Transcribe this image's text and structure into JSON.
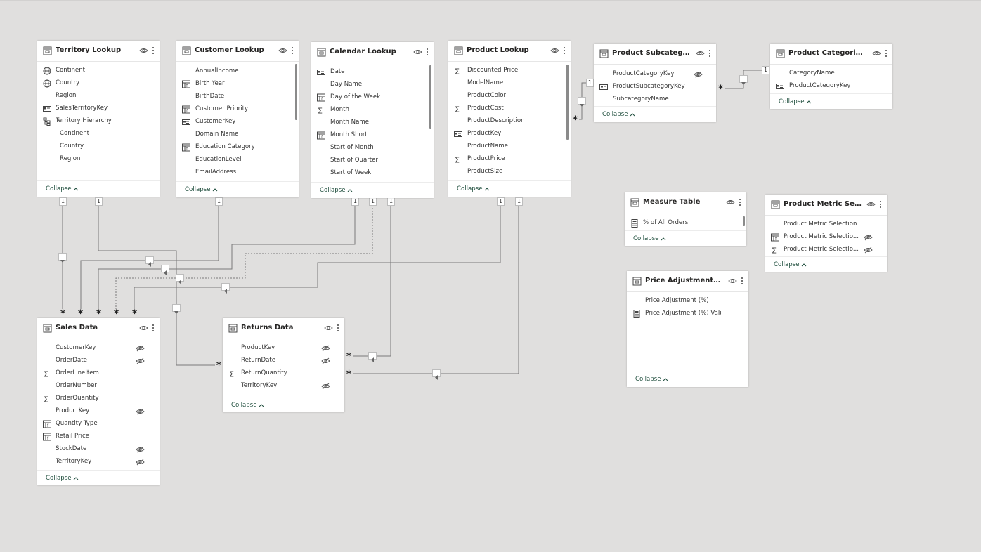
{
  "tables": [
    {
      "id": "territory",
      "title": "Territory Lookup",
      "collapse": "Collapse",
      "fields": [
        {
          "label": "Continent",
          "icon": "globe-icon",
          "hidden": false
        },
        {
          "label": "Country",
          "icon": "globe-icon",
          "hidden": false
        },
        {
          "label": "Region",
          "icon": "",
          "hidden": false
        },
        {
          "label": "SalesTerritoryKey",
          "icon": "id-card-icon",
          "hidden": false
        },
        {
          "label": "Territory Hierarchy",
          "icon": "hierarchy-icon",
          "hidden": false
        },
        {
          "label": "Continent",
          "icon": "",
          "hidden": false,
          "indent": true
        },
        {
          "label": "Country",
          "icon": "",
          "hidden": false,
          "indent": true
        },
        {
          "label": "Region",
          "icon": "",
          "hidden": false,
          "indent": true
        }
      ]
    },
    {
      "id": "customer",
      "title": "Customer Lookup",
      "collapse": "Collapse",
      "fields": [
        {
          "label": "AnnualIncome",
          "icon": "",
          "hidden": false
        },
        {
          "label": "Birth Year",
          "icon": "calculated-column-icon",
          "hidden": false
        },
        {
          "label": "BirthDate",
          "icon": "",
          "hidden": false
        },
        {
          "label": "Customer Priority",
          "icon": "calculated-column-icon",
          "hidden": false
        },
        {
          "label": "CustomerKey",
          "icon": "id-card-icon",
          "hidden": false
        },
        {
          "label": "Domain Name",
          "icon": "",
          "hidden": false
        },
        {
          "label": "Education Category",
          "icon": "calculated-column-icon",
          "hidden": false
        },
        {
          "label": "EducationLevel",
          "icon": "",
          "hidden": false
        },
        {
          "label": "EmailAddress",
          "icon": "",
          "hidden": false
        }
      ]
    },
    {
      "id": "calendar",
      "title": "Calendar Lookup",
      "collapse": "Collapse",
      "fields": [
        {
          "label": "Date",
          "icon": "id-card-icon",
          "hidden": false
        },
        {
          "label": "Day Name",
          "icon": "",
          "hidden": false
        },
        {
          "label": "Day of the Week",
          "icon": "calculated-column-icon",
          "hidden": false
        },
        {
          "label": "Month",
          "icon": "sigma-icon",
          "hidden": false
        },
        {
          "label": "Month Name",
          "icon": "",
          "hidden": false
        },
        {
          "label": "Month Short",
          "icon": "calculated-column-icon",
          "hidden": false
        },
        {
          "label": "Start of Month",
          "icon": "",
          "hidden": false
        },
        {
          "label": "Start of Quarter",
          "icon": "",
          "hidden": false
        },
        {
          "label": "Start of Week",
          "icon": "",
          "hidden": false
        }
      ]
    },
    {
      "id": "product",
      "title": "Product Lookup",
      "collapse": "Collapse",
      "fields": [
        {
          "label": "Discounted Price",
          "icon": "sigma-icon",
          "hidden": false
        },
        {
          "label": "ModelName",
          "icon": "",
          "hidden": false
        },
        {
          "label": "ProductColor",
          "icon": "",
          "hidden": false
        },
        {
          "label": "ProductCost",
          "icon": "sigma-icon",
          "hidden": false
        },
        {
          "label": "ProductDescription",
          "icon": "",
          "hidden": false
        },
        {
          "label": "ProductKey",
          "icon": "id-card-icon",
          "hidden": false
        },
        {
          "label": "ProductName",
          "icon": "",
          "hidden": false
        },
        {
          "label": "ProductPrice",
          "icon": "sigma-icon",
          "hidden": false
        },
        {
          "label": "ProductSize",
          "icon": "",
          "hidden": false
        }
      ]
    },
    {
      "id": "subcategories",
      "title": "Product Subcategorie...",
      "collapse": "Collapse",
      "fields": [
        {
          "label": "ProductCategoryKey",
          "icon": "",
          "hidden": true
        },
        {
          "label": "ProductSubcategoryKey",
          "icon": "id-card-icon",
          "hidden": false
        },
        {
          "label": "SubcategoryName",
          "icon": "",
          "hidden": false
        }
      ]
    },
    {
      "id": "categories",
      "title": "Product Categories L...",
      "collapse": "Collapse",
      "fields": [
        {
          "label": "CategoryName",
          "icon": "",
          "hidden": false
        },
        {
          "label": "ProductCategoryKey",
          "icon": "id-card-icon",
          "hidden": false
        }
      ]
    },
    {
      "id": "measure",
      "title": "Measure Table",
      "collapse": "Collapse",
      "fields": [
        {
          "label": "% of All Orders",
          "icon": "calculator-icon",
          "hidden": false
        }
      ]
    },
    {
      "id": "metric",
      "title": "Product Metric Select...",
      "collapse": "Collapse",
      "fields": [
        {
          "label": "Product Metric Selection",
          "icon": "",
          "hidden": false
        },
        {
          "label": "Product Metric Selectio...",
          "icon": "calculated-column-icon",
          "hidden": true
        },
        {
          "label": "Product Metric Selectio...",
          "icon": "sigma-icon",
          "hidden": true
        }
      ]
    },
    {
      "id": "price",
      "title": "Price Adjustment (%)",
      "collapse": "Collapse",
      "fields": [
        {
          "label": "Price Adjustment (%)",
          "icon": "",
          "hidden": false
        },
        {
          "label": "Price Adjustment (%) Value",
          "icon": "calculator-icon",
          "hidden": false
        }
      ]
    },
    {
      "id": "sales",
      "title": "Sales Data",
      "collapse": "Collapse",
      "fields": [
        {
          "label": "CustomerKey",
          "icon": "",
          "hidden": true
        },
        {
          "label": "OrderDate",
          "icon": "",
          "hidden": true
        },
        {
          "label": "OrderLineItem",
          "icon": "sigma-icon",
          "hidden": false
        },
        {
          "label": "OrderNumber",
          "icon": "",
          "hidden": false
        },
        {
          "label": "OrderQuantity",
          "icon": "sigma-icon",
          "hidden": false
        },
        {
          "label": "ProductKey",
          "icon": "",
          "hidden": true
        },
        {
          "label": "Quantity Type",
          "icon": "calculated-column-icon",
          "hidden": false
        },
        {
          "label": "Retail Price",
          "icon": "calculated-column-icon",
          "hidden": false
        },
        {
          "label": "StockDate",
          "icon": "",
          "hidden": true
        },
        {
          "label": "TerritoryKey",
          "icon": "",
          "hidden": true
        }
      ]
    },
    {
      "id": "returns",
      "title": "Returns Data",
      "collapse": "Collapse",
      "fields": [
        {
          "label": "ProductKey",
          "icon": "",
          "hidden": true
        },
        {
          "label": "ReturnDate",
          "icon": "",
          "hidden": true
        },
        {
          "label": "ReturnQuantity",
          "icon": "sigma-icon",
          "hidden": false
        },
        {
          "label": "TerritoryKey",
          "icon": "",
          "hidden": true
        }
      ]
    }
  ],
  "cardinality": {
    "one": "1",
    "many": "*"
  }
}
